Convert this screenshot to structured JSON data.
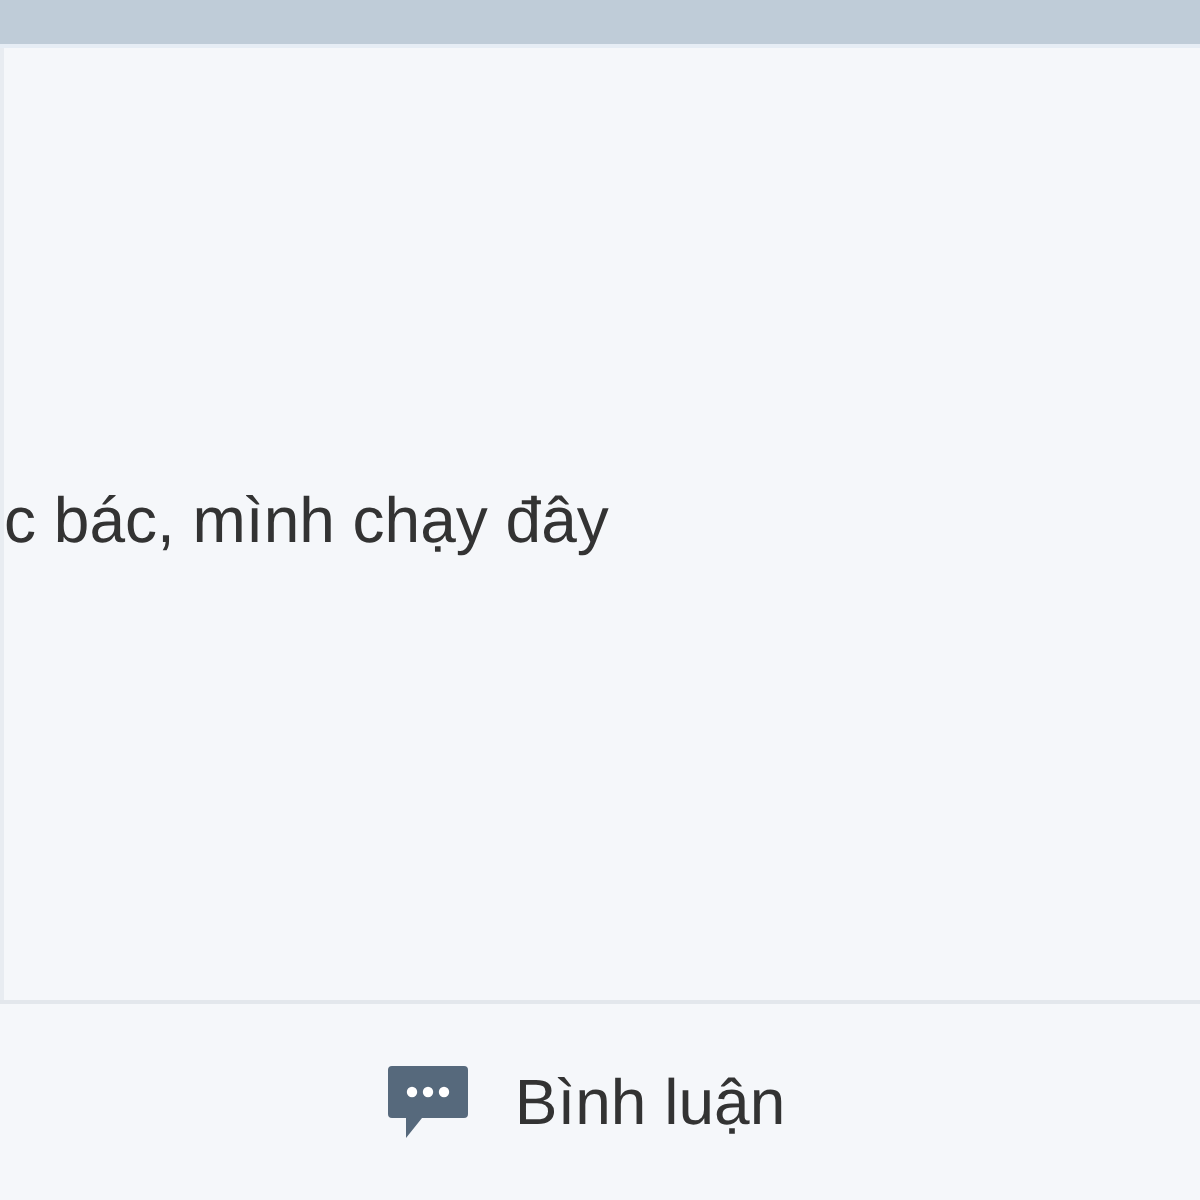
{
  "post": {
    "body": "c bác, mình chạy đây"
  },
  "actions": [
    {
      "kind": "comment",
      "label": "Bình luận"
    }
  ]
}
